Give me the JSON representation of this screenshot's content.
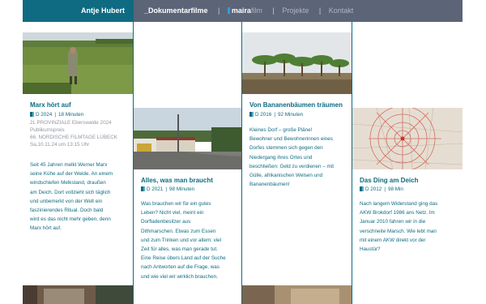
{
  "header": {
    "brand": "Antje Hubert",
    "nav": {
      "documentary": "_Dokumentarfilme",
      "maira_bold": "maira",
      "maira_rest": "film",
      "projects": "Projekte",
      "contact": "Kontakt",
      "separator": "|"
    }
  },
  "films": [
    {
      "title": "Marx hört auf",
      "year": "D 2024",
      "duration": "18 Minuten",
      "extra": [
        "2L PROVINZIALE Eberswalde 2024",
        "Publikumspreis",
        "66. NORDISCHE FILMTAGE LÜBECK",
        "Sa,10.11.24 um 13:15 Uhr"
      ],
      "desc": [
        "Seit 45 Jahren melkt Werner Marx",
        "seine Kühe auf der Weide. An einem",
        "windschiefen Melkstand, draußen",
        "am Deich. Dort vollzieht sich täglich",
        "und unbemerkt von der Welt ein",
        "faszinierendes Ritual. Doch bald",
        "wird es das nicht mehr geben, denn",
        "Marx hört auf."
      ]
    },
    {
      "title": "Alles, was man braucht",
      "year": "D 2021",
      "duration": "98 Minuten",
      "desc": [
        "Was brauchen wir für ein gutes",
        "Leben? Nicht viel, meint ein",
        "Dorfladenbesitzer aus",
        "Dithmarschen. Etwas zum Essen",
        "und zum Trinken und vor allem: viel",
        "Zeit für alles, was man gerade tut.",
        "Eine Reise übers Land auf der Suche",
        "nach Antworten auf die Frage, was",
        "und wie viel wir wirklich brauchen."
      ]
    },
    {
      "title": "Von Bananenbäumen träumen",
      "year": "D 2016",
      "duration": "92 Minuten",
      "desc": [
        "Kleines Dorf – große Pläne!",
        "Bewohner und Bewohnerinnen eines",
        "Dorfes stemmen sich gegen den",
        "Niedergang ihres Ortes und",
        "beschließen: Geld zu verdienen – mit",
        "Gülle, afrikanischen Welsen und",
        "Bananenbäumen!"
      ]
    },
    {
      "title": "Das Ding am Deich",
      "year": "D 2012",
      "duration": "98 Min",
      "desc": [
        "Nach langem Widerstand ging das",
        "AKW Brokdorf 1986 ans Netz. Im",
        "Januar 2010 fahren wir in die",
        "verschneite Marsch. Wie lebt man",
        "mit einem AKW direkt vor der",
        "Haustür?"
      ]
    }
  ],
  "colors": {
    "accent": "#0f6b82",
    "header_bg": "#5c6477",
    "muted": "#8f96a3"
  }
}
